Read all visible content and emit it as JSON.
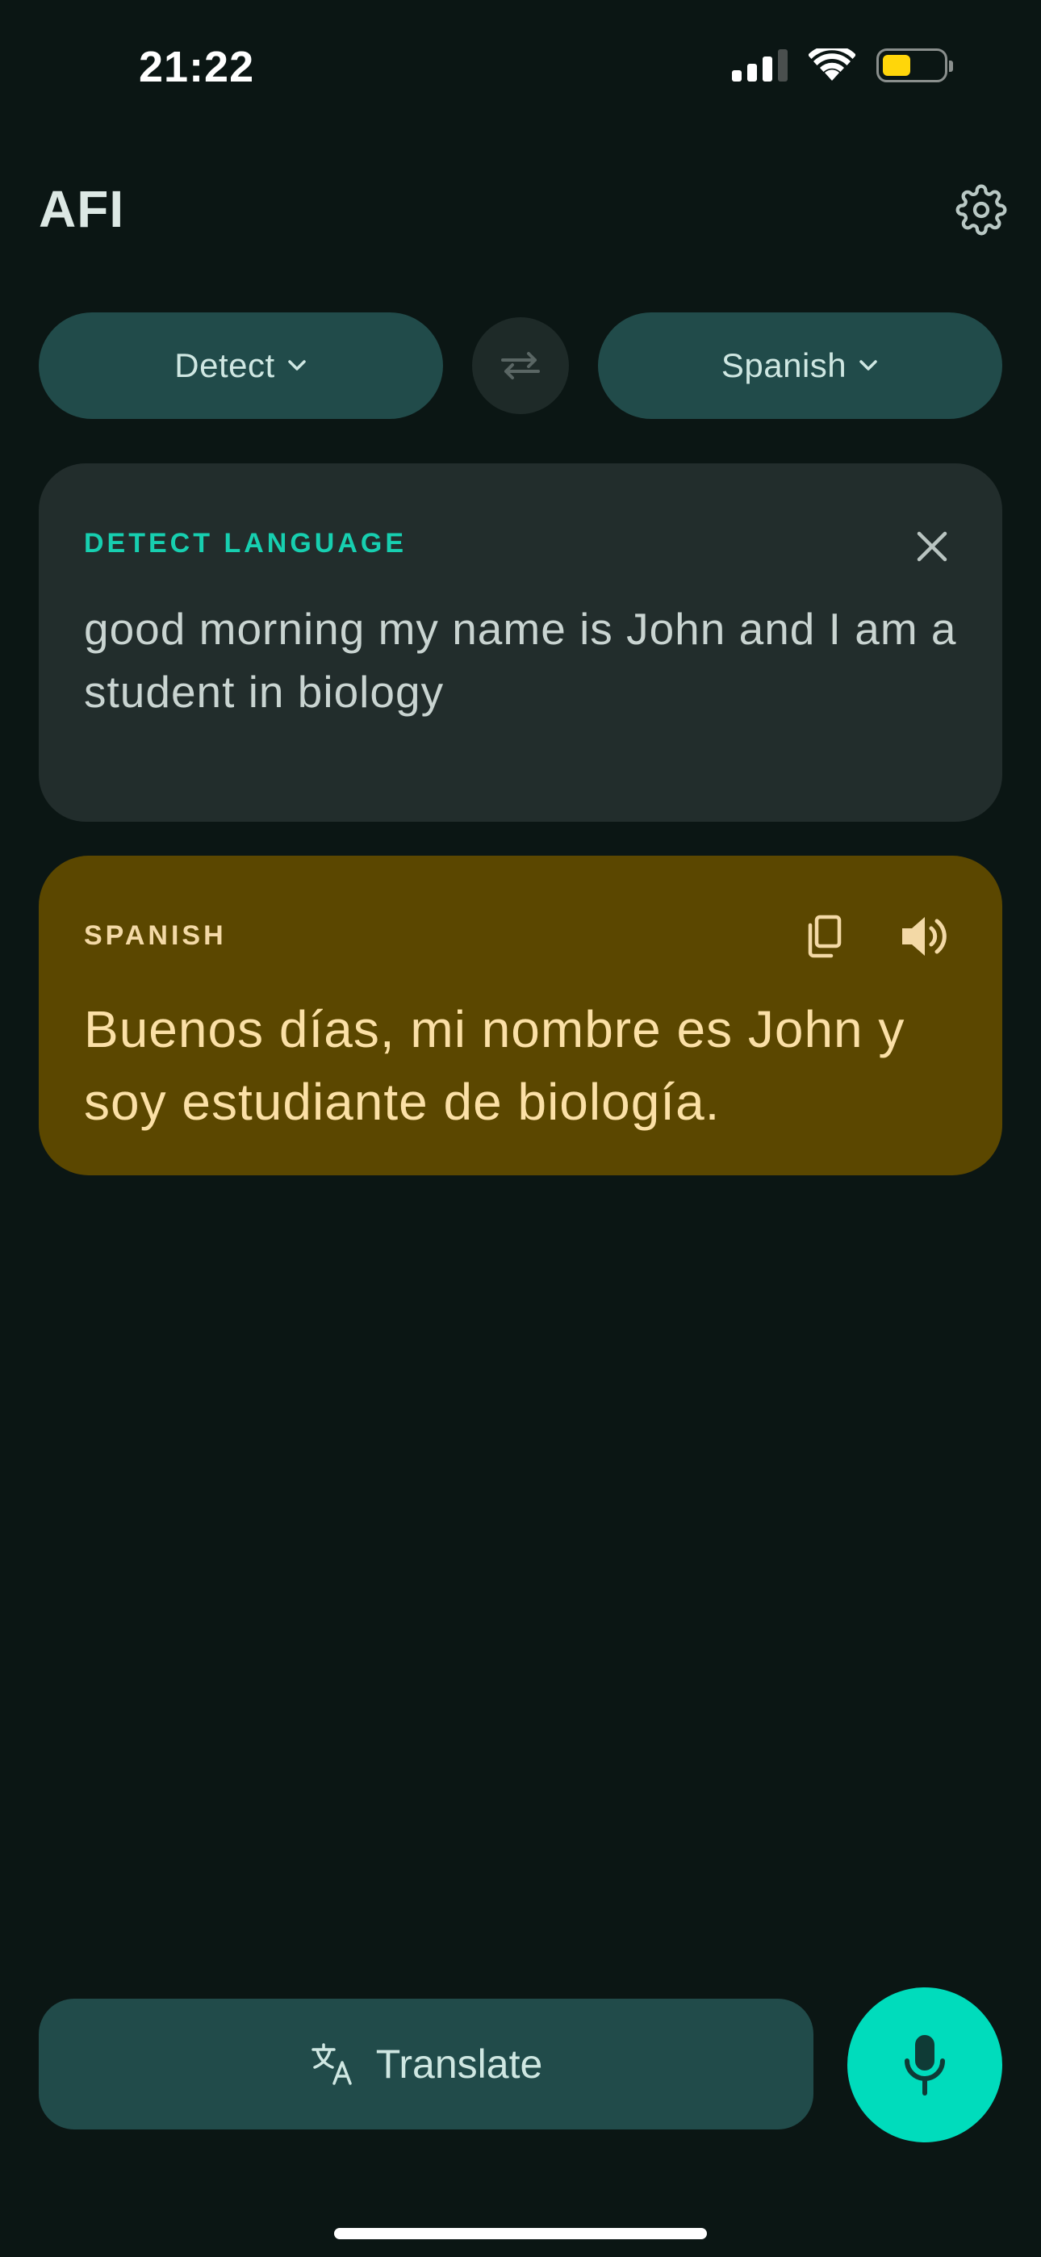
{
  "status_bar": {
    "time": "21:22",
    "battery_level": 0.45,
    "signal_bars": 3,
    "icons": [
      "cellular-signal-icon",
      "wifi-icon",
      "battery-icon"
    ]
  },
  "header": {
    "title": "AFI",
    "settings_icon": "gear-icon"
  },
  "language_selector": {
    "source_label": "Detect",
    "target_label": "Spanish",
    "swap_icon": "swap-arrows-icon"
  },
  "source_card": {
    "label": "DETECT LANGUAGE",
    "text": "good morning my name is John and I am a student in biology",
    "clear_icon": "close-icon"
  },
  "target_card": {
    "label": "SPANISH",
    "text": "Buenos días, mi nombre es John y soy estudiante de biología.",
    "copy_icon": "copy-icon",
    "speak_icon": "speaker-icon"
  },
  "actions": {
    "translate_label": "Translate",
    "translate_icon": "translate-icon",
    "mic_icon": "microphone-icon"
  },
  "colors": {
    "background": "#0b1614",
    "accent": "#00dcbc",
    "pill": "#214b4a",
    "source_card": "#222d2c",
    "target_card": "#5b4700",
    "target_text": "#fbe0a6",
    "battery": "#ffd60a"
  }
}
